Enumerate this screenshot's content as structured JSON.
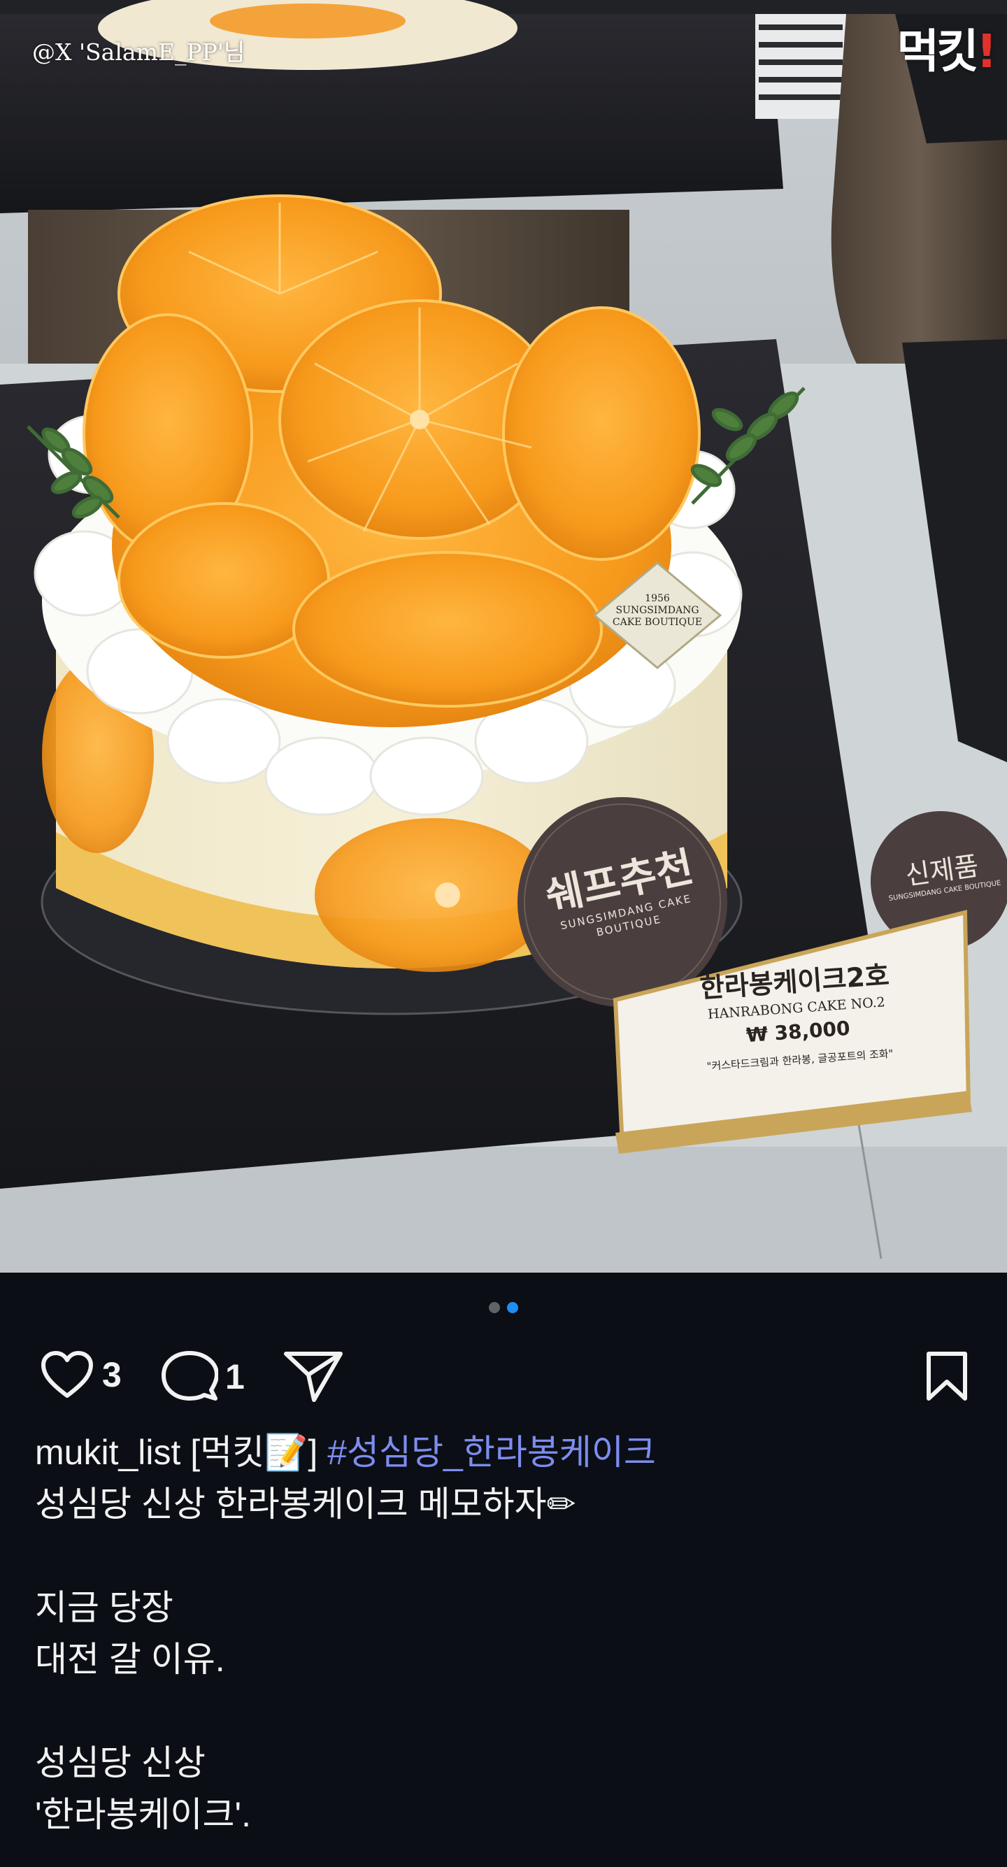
{
  "photo": {
    "watermark": "@X 'SalamE_PP'님",
    "brand_logo": {
      "text": "먹킷",
      "accent": "!"
    },
    "cake_badge": {
      "year": "1956",
      "line1": "SUNGSIMDANG",
      "line2": "CAKE BOUTIQUE"
    },
    "chef_sticker": {
      "text": "쉐프추천",
      "sub": "SUNGSIMDANG CAKE BOUTIQUE"
    },
    "new_sticker": {
      "text": "신제품",
      "sub": "SUNGSIMDANG CAKE BOUTIQUE"
    },
    "price_card": {
      "name_ko": "한라봉케이크2호",
      "name_en": "HANRABONG CAKE NO.2",
      "price": "₩ 38,000",
      "desc": "\"커스타드크림과 한라봉, 글공포트의 조화\""
    }
  },
  "carousel": {
    "count": 2,
    "active_index": 1
  },
  "actions": {
    "likes": "3",
    "comments": "1"
  },
  "caption": {
    "username": "mukit_list",
    "handle_label": "[먹킷📝]",
    "hashtag": "#성심당_한라봉케이크",
    "lines": [
      "성심당 신상 한라봉케이크 메모하자✏",
      "",
      "지금 당장",
      "대전 갈 이유.",
      "",
      "성심당 신상",
      "'한라봉케이크'."
    ]
  },
  "colors": {
    "background": "#0b0f15",
    "text": "#f2f2f2",
    "hashtag": "#7e8cf0",
    "dot_active": "#1f8ef1",
    "dot_inactive": "#5f6368"
  }
}
